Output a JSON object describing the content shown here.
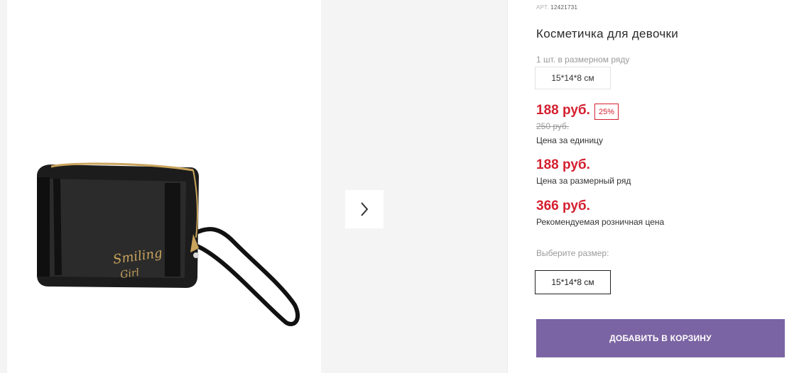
{
  "gallery": {
    "next_icon": "chevron-right-icon",
    "product_print_line1": "Smiling",
    "product_print_line2": "Girl"
  },
  "product": {
    "art_label": "АРТ.",
    "art_number": "12421731",
    "title": "Косметичка для девочки",
    "pack_note": "1 шт. в размерном ряду",
    "pack_size": "15*14*8 см"
  },
  "pricing": {
    "unit_price": "188 руб.",
    "discount": "25%",
    "old_price": "250 руб.",
    "unit_price_label": "Цена за единицу",
    "row_price": "188 руб.",
    "row_price_label": "Цена за размерный ряд",
    "retail_price": "366 руб.",
    "retail_price_label": "Рекомендуемая розничная цена"
  },
  "size_selector": {
    "label": "Выберите размер:",
    "selected": "15*14*8 см"
  },
  "actions": {
    "add_to_cart": "ДОБАВИТЬ В КОРЗИНУ"
  },
  "colors": {
    "price_red": "#d42030",
    "button_purple": "#7b64a3",
    "gallery_gray": "#f4f4f4"
  }
}
